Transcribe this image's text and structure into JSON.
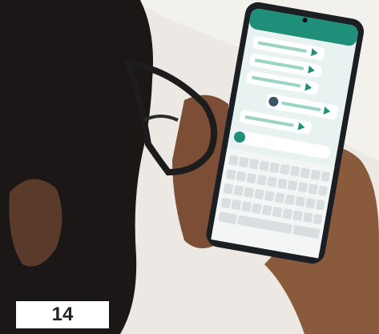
{
  "image": {
    "description_label": "",
    "caption_number": "14",
    "colors": {
      "background": "#e9e7e2",
      "phone_body": "#1b1f24",
      "screen_bg": "#e8f3f1",
      "chat_header": "#1f8f7a",
      "bubble": "#ffffff",
      "voice_wave": "#9bd3c4",
      "skin": "#8a5a3c",
      "hair": "#1a1716"
    }
  }
}
